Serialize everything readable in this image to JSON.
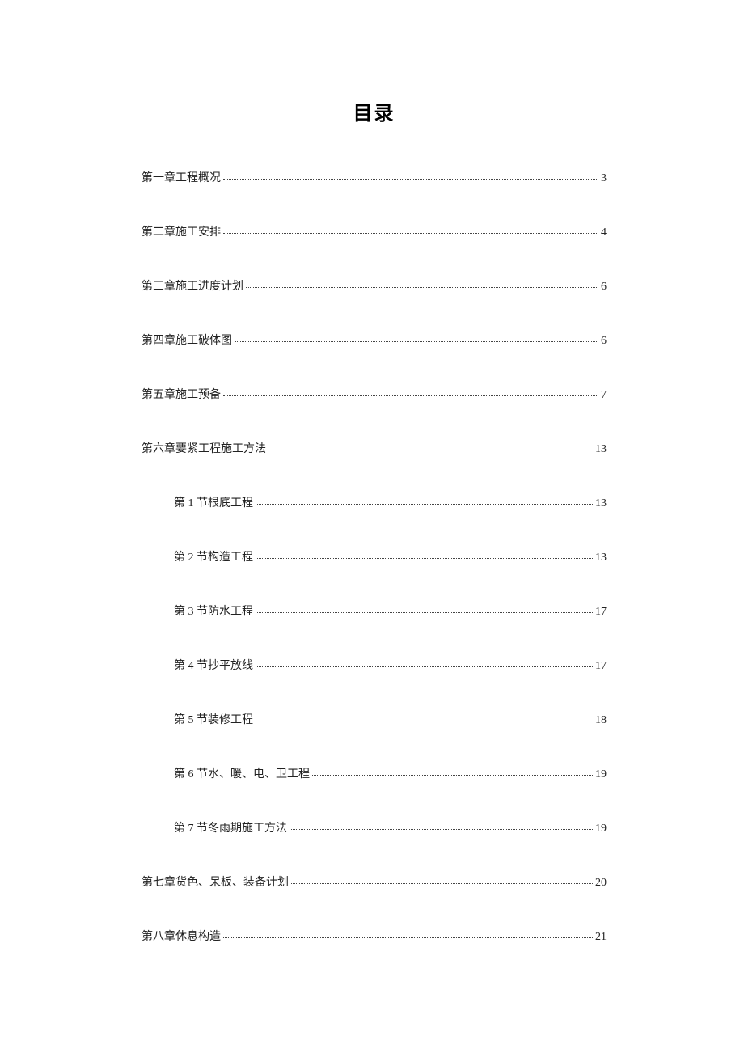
{
  "title": "目录",
  "entries": [
    {
      "label": "第一章工程概况",
      "page": "3",
      "sub": false
    },
    {
      "label": "第二章施工安排",
      "page": "4",
      "sub": false
    },
    {
      "label": "第三章施工进度计划",
      "page": "6",
      "sub": false
    },
    {
      "label": "第四章施工破体图",
      "page": "6",
      "sub": false
    },
    {
      "label": "第五章施工预备",
      "page": "7",
      "sub": false
    },
    {
      "label": "第六章要紧工程施工方法",
      "page": "13",
      "sub": false
    },
    {
      "label": "第 1 节根底工程",
      "page": "13",
      "sub": true
    },
    {
      "label": "第 2 节构造工程",
      "page": "13",
      "sub": true
    },
    {
      "label": "第 3 节防水工程",
      "page": "17",
      "sub": true
    },
    {
      "label": "第 4 节抄平放线",
      "page": "17",
      "sub": true
    },
    {
      "label": "第 5 节装修工程",
      "page": "18",
      "sub": true
    },
    {
      "label": "第 6 节水、暖、电、卫工程",
      "page": "19",
      "sub": true
    },
    {
      "label": "第 7 节冬雨期施工方法",
      "page": "19",
      "sub": true
    },
    {
      "label": "第七章货色、呆板、装备计划",
      "page": "20",
      "sub": false
    },
    {
      "label": "第八章休息构造",
      "page": "21",
      "sub": false
    }
  ]
}
